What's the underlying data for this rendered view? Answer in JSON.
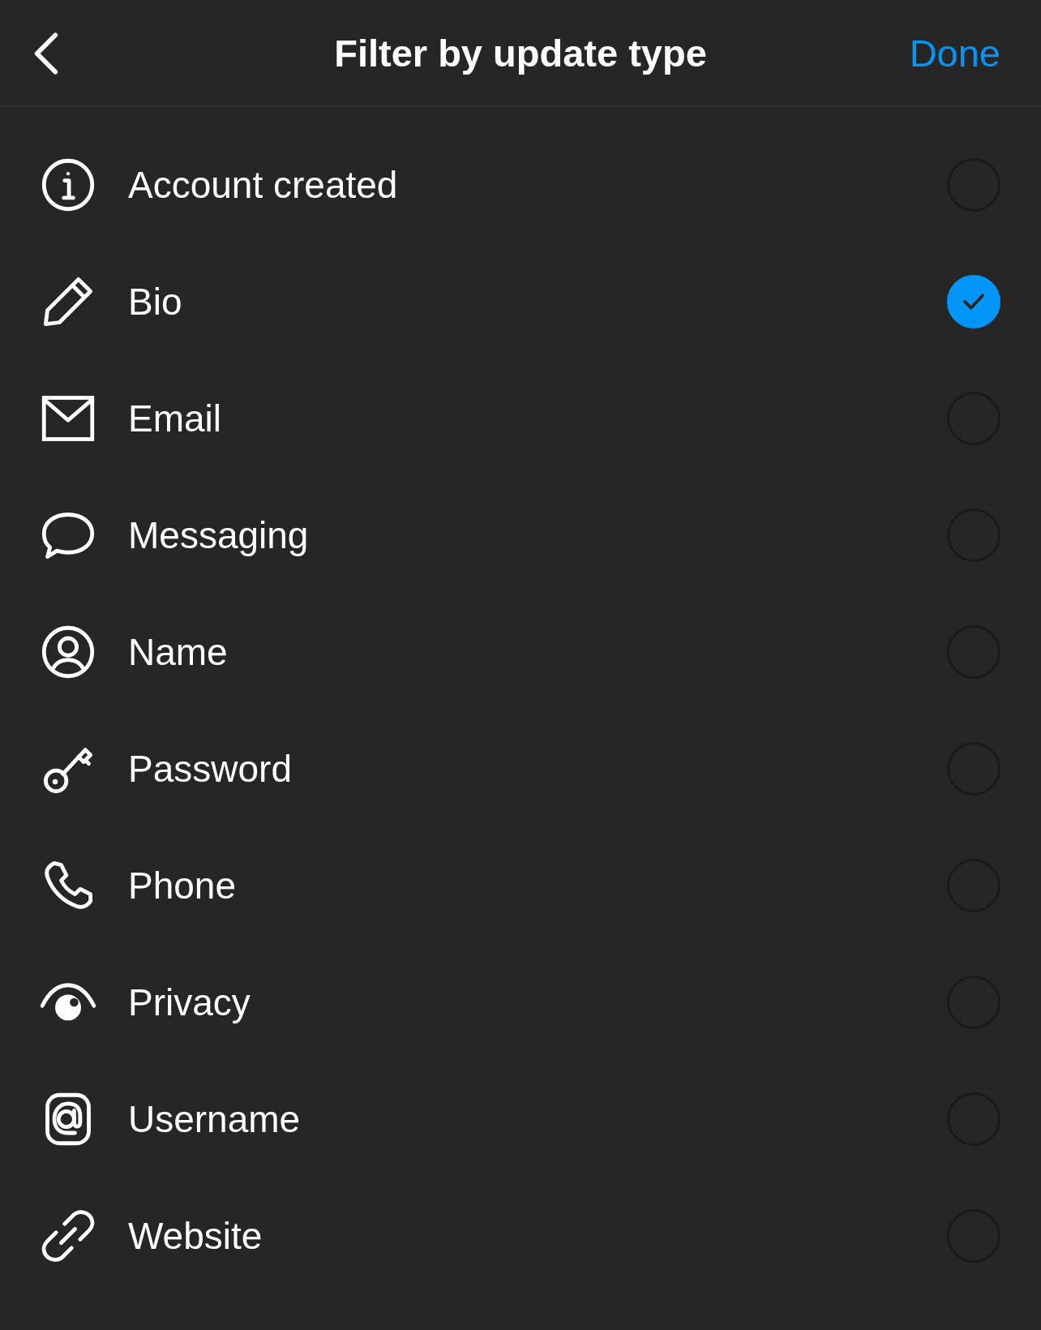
{
  "header": {
    "title": "Filter by update type",
    "done_label": "Done"
  },
  "options": [
    {
      "label": "Account created",
      "selected": false
    },
    {
      "label": "Bio",
      "selected": true
    },
    {
      "label": "Email",
      "selected": false
    },
    {
      "label": "Messaging",
      "selected": false
    },
    {
      "label": "Name",
      "selected": false
    },
    {
      "label": "Password",
      "selected": false
    },
    {
      "label": "Phone",
      "selected": false
    },
    {
      "label": "Privacy",
      "selected": false
    },
    {
      "label": "Username",
      "selected": false
    },
    {
      "label": "Website",
      "selected": false
    }
  ]
}
